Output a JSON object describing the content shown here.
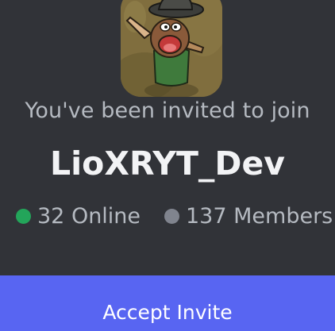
{
  "invite": {
    "subtitle": "You've been invited to join",
    "server_name": "LioXRYT_Dev",
    "online_label": "32 Online",
    "members_label": "137 Members",
    "accept_label": "Accept Invite"
  },
  "colors": {
    "background": "#313338",
    "online_dot": "#23a55a",
    "members_dot": "#80848e",
    "accent_button": "#5865f2"
  },
  "icons": {
    "server_icon": "cartoon-character-avatar"
  }
}
